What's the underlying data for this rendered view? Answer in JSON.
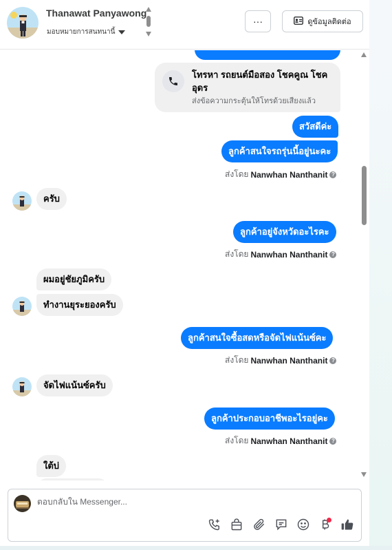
{
  "header": {
    "contact_name": "Thanawat Panyawong",
    "assign_label": "มอบหมายการสนทนานี้",
    "more_label": "···",
    "contact_info_label": "ดูข้อมูลติดต่อ"
  },
  "call_card": {
    "title": "โทรหา รถยนต์มือสอง โชคคูณ โชค อุดร",
    "subtitle": "ส่งข้อความกระตุ้นให้โทรด้วยเสียงแล้ว"
  },
  "messages": [
    {
      "direction": "out",
      "text": "สวัสดีค่ะ"
    },
    {
      "direction": "out",
      "text": "ลูกค้าสนใจรถรุ่นนี้อยู่นะคะ"
    },
    {
      "direction": "in",
      "text": "ครับ"
    },
    {
      "direction": "out",
      "text": "ลูกค้าอยู่จังหวัดอะไรคะ"
    },
    {
      "direction": "in",
      "text": "ผมอยู่ชัยภูมิครับ"
    },
    {
      "direction": "in",
      "text": "ทำงานยุระยองครับ"
    },
    {
      "direction": "out",
      "text": "ลูกค้าสนใจซื้อสดหรือจัดไฟแน้นซ์คะ"
    },
    {
      "direction": "in",
      "text": "จัดไฟแน้นซ์ครับ"
    },
    {
      "direction": "out",
      "text": "ลูกค้าประกอบอาชีพอะไรอยู่คะ"
    },
    {
      "direction": "in",
      "text": "ใต้บ่"
    }
  ],
  "sent_by": {
    "prefix": "ส่งโดย",
    "name": "Nanwhan Nanthanit"
  },
  "composer": {
    "placeholder": "ตอบกลับใน Messenger..."
  },
  "tools": [
    "call-plus-icon",
    "shopping-bag-icon",
    "paperclip-icon",
    "saved-reply-icon",
    "emoji-icon",
    "baht-icon",
    "thumbs-up-icon"
  ],
  "colors": {
    "outgoing_bubble": "#0a7cff",
    "incoming_bubble": "#f0f0f0",
    "notification_dot": "#f02849"
  }
}
